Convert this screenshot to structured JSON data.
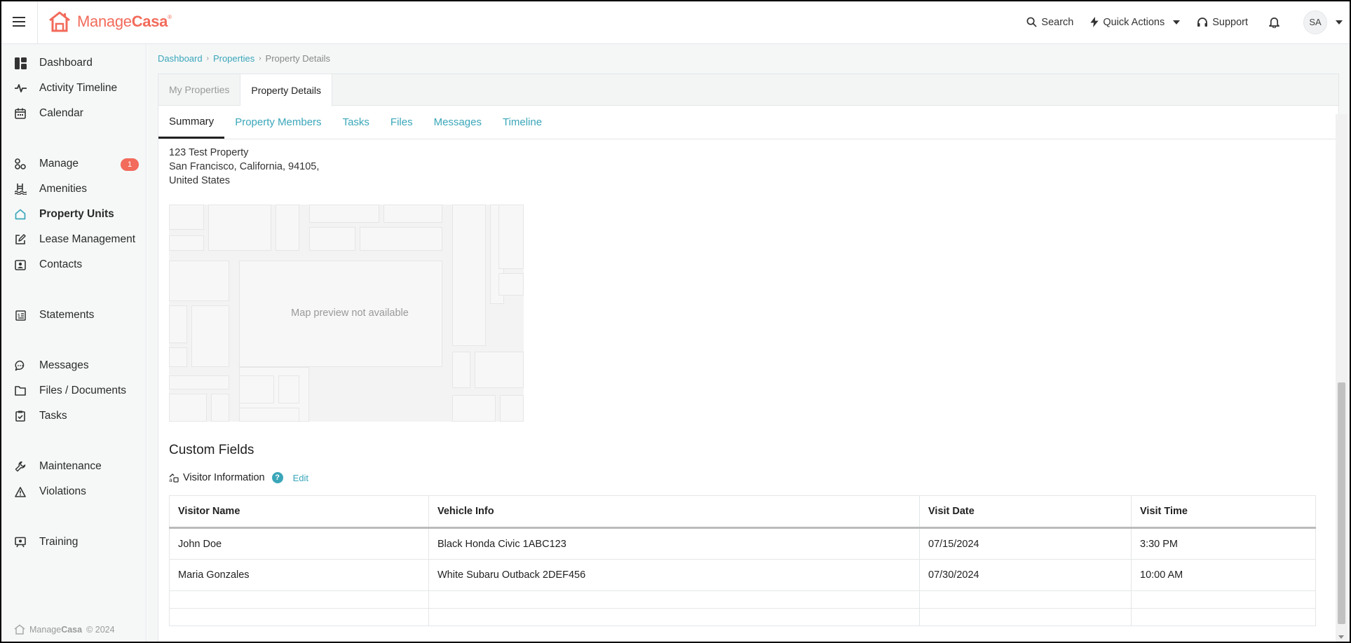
{
  "header": {
    "brand_plain": "Manage",
    "brand_bold": "Casa",
    "brand_reg": "®",
    "search_label": "Search",
    "quick_actions_label": "Quick Actions",
    "support_label": "Support",
    "avatar_initials": "SA"
  },
  "sidebar": {
    "items": [
      {
        "label": "Dashboard",
        "icon": "dashboard-icon"
      },
      {
        "label": "Activity Timeline",
        "icon": "activity-icon"
      },
      {
        "label": "Calendar",
        "icon": "calendar-icon"
      },
      {
        "label": "Manage",
        "icon": "manage-icon",
        "badge": "1"
      },
      {
        "label": "Amenities",
        "icon": "pool-icon"
      },
      {
        "label": "Property Units",
        "icon": "home-icon",
        "active": true
      },
      {
        "label": "Lease Management",
        "icon": "edit-icon"
      },
      {
        "label": "Contacts",
        "icon": "contacts-icon"
      },
      {
        "label": "Statements",
        "icon": "statement-icon"
      },
      {
        "label": "Messages",
        "icon": "chat-icon"
      },
      {
        "label": "Files / Documents",
        "icon": "folder-icon"
      },
      {
        "label": "Tasks",
        "icon": "task-icon"
      },
      {
        "label": "Maintenance",
        "icon": "wrench-icon"
      },
      {
        "label": "Violations",
        "icon": "warning-icon"
      },
      {
        "label": "Training",
        "icon": "training-icon"
      }
    ],
    "copyright_plain": "Manage",
    "copyright_bold": "Casa",
    "copyright_year": "© 2024"
  },
  "breadcrumb": {
    "items": [
      "Dashboard",
      "Properties",
      "Property Details"
    ]
  },
  "tabs_top": [
    "My Properties",
    "Property Details"
  ],
  "tabs_sub": [
    "Summary",
    "Property Members",
    "Tasks",
    "Files",
    "Messages",
    "Timeline"
  ],
  "address": {
    "line1": "123 Test Property",
    "line2": "San Francisco, California, 94105,",
    "line3": "United States"
  },
  "map": {
    "placeholder": "Map preview not available"
  },
  "custom_fields": {
    "title": "Custom Fields",
    "section_label": "Visitor Information",
    "help_label": "?",
    "edit_label": "Edit",
    "columns": [
      "Visitor Name",
      "Vehicle Info",
      "Visit Date",
      "Visit Time"
    ],
    "rows": [
      [
        "John Doe",
        "Black Honda Civic 1ABC123",
        "07/15/2024",
        "3:30 PM"
      ],
      [
        "Maria Gonzales",
        "White Subaru Outback 2DEF456",
        "07/30/2024",
        "10:00 AM"
      ]
    ]
  },
  "colors": {
    "brand": "#f26b5b",
    "link": "#3aa6b9",
    "sidebar_bg": "#f6f8f8"
  }
}
